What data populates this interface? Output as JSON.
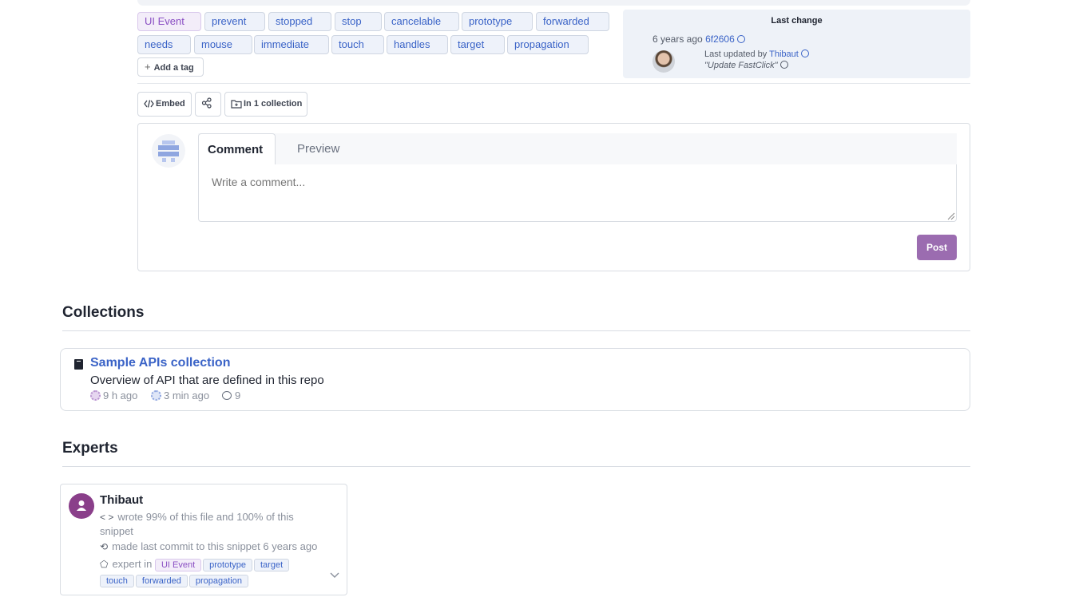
{
  "tags": {
    "row1": [
      "UI Event",
      "prevent",
      "stopped",
      "stop",
      "cancelable",
      "prototype",
      "forwarded"
    ],
    "row2": [
      "needs",
      "mouse",
      "immediate",
      "touch",
      "handles",
      "target",
      "propagation"
    ],
    "add_tag_label": "Add a tag"
  },
  "last_change": {
    "title": "Last change",
    "age": "6 years ago",
    "commit": "6f2606",
    "updated_by_prefix": "Last updated by",
    "updated_by": "Thibaut",
    "commit_message": "\"Update FastClick\""
  },
  "actions": {
    "embed_label": "Embed",
    "collection_label": "In 1 collection"
  },
  "comment": {
    "tab_comment": "Comment",
    "tab_preview": "Preview",
    "placeholder": "Write a comment...",
    "post_label": "Post"
  },
  "collections": {
    "heading": "Collections",
    "items": [
      {
        "name": "Sample APIs collection",
        "description": "Overview of API that are defined in this repo",
        "created": "9 h ago",
        "updated": "3 min ago",
        "comments": "9"
      }
    ]
  },
  "experts": {
    "heading": "Experts",
    "items": [
      {
        "name": "Thibaut",
        "wrote": "wrote 99% of this file and 100% of this snippet",
        "last_commit": "made last commit to this snippet 6 years ago",
        "expert_prefix": "expert in",
        "expert_tags": [
          "UI Event",
          "prototype",
          "target",
          "touch",
          "forwarded",
          "propagation"
        ]
      }
    ]
  },
  "colors": {
    "accent": "#3a63c7",
    "post_button": "#9b6cb0",
    "ui_event_tag": "#8a4fc3",
    "expert_avatar": "#8a3f8a"
  }
}
